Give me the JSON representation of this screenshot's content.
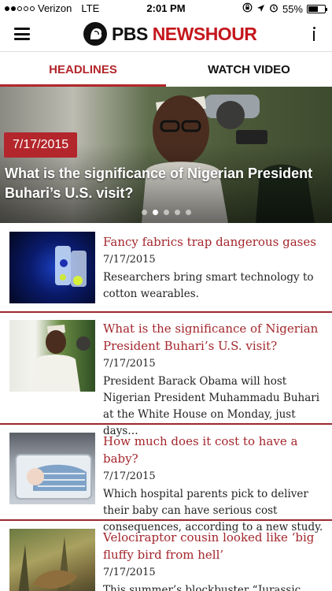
{
  "status_bar": {
    "carrier": "Verizon",
    "network": "LTE",
    "time": "2:01 PM",
    "battery": "55%"
  },
  "header": {
    "logo_pbs": "PBS",
    "logo_newshour": "NEWSHOUR"
  },
  "tabs": [
    {
      "label": "HEADLINES",
      "active": true
    },
    {
      "label": "WATCH VIDEO",
      "active": false
    }
  ],
  "hero": {
    "date": "7/17/2015",
    "title": "What is the significance of Nigerian President Buhari’s U.S. visit?",
    "page_count": 5,
    "current_page": 2
  },
  "articles": [
    {
      "title": "Fancy fabrics trap dangerous gases",
      "date": "7/17/2015",
      "summary": "Researchers bring smart technology to cotton wearables."
    },
    {
      "title": "What is the significance of Nigerian President Buhari’s U.S. visit?",
      "date": "7/17/2015",
      "summary": "President Barack Obama will host Nigerian President Muhammadu Buhari at the White House on Monday, just days…"
    },
    {
      "title": "How much does it cost to have a baby?",
      "date": "7/17/2015",
      "summary": "Which hospital parents pick to deliver their baby can have serious cost consequences, according to a new study."
    },
    {
      "title": "Velociraptor cousin looked like ‘big fluffy bird from hell’",
      "date": "7/17/2015",
      "summary": "This summer’s blockbuster “Jurassic"
    }
  ],
  "colors": {
    "brand_red": "#b3262b",
    "headline_red": "#a3262c",
    "divider": "#9b2a2f"
  }
}
